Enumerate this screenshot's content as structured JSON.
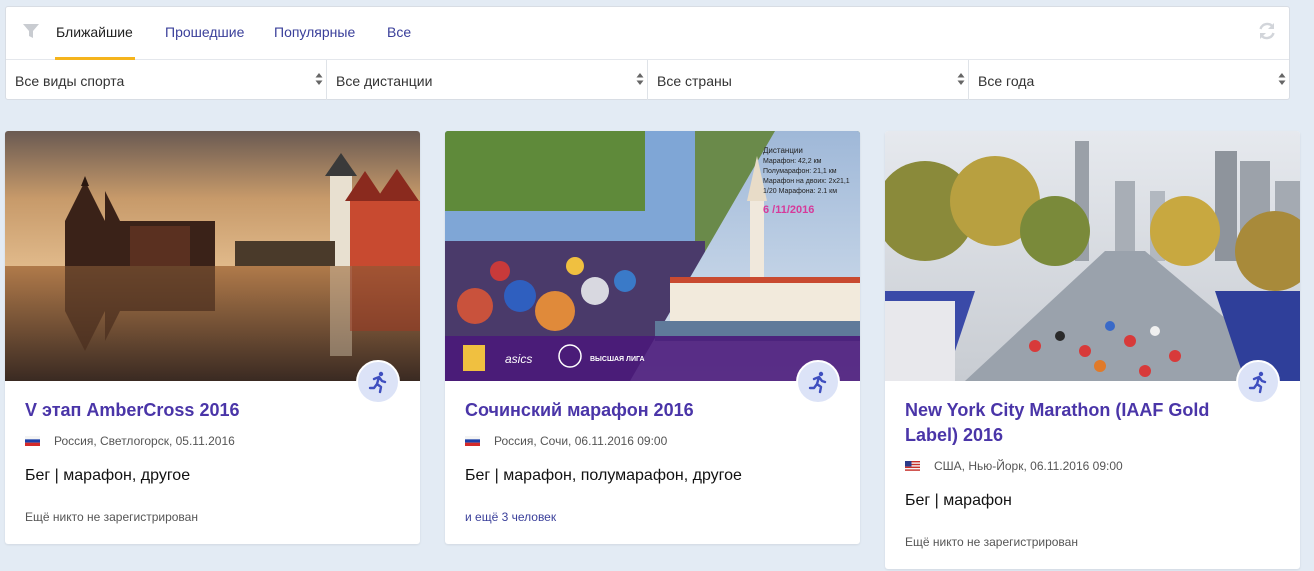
{
  "tabs": [
    {
      "label": "Ближайшие",
      "active": true
    },
    {
      "label": "Прошедшие",
      "active": false
    },
    {
      "label": "Популярные",
      "active": false
    },
    {
      "label": "Все",
      "active": false
    }
  ],
  "filters": [
    {
      "value": "Все виды спорта"
    },
    {
      "value": "Все дистанции"
    },
    {
      "value": "Все страны"
    },
    {
      "value": "Все года"
    }
  ],
  "icons": {
    "filter": "filter-icon",
    "refresh": "refresh-icon",
    "sport": "running-man-icon",
    "sort": "sort-arrows-icon"
  },
  "colors": {
    "accent": "#f5b41c",
    "title": "#4a35a8",
    "link": "#3a3f9a",
    "badge": "#dce3f7"
  },
  "cards": [
    {
      "title": "V этап AmberCross 2016",
      "flag": "russia",
      "location": "Россия, Светлогорск, 05.11.2016",
      "sports": "Бег | марафон, другое",
      "registration": "Ещё никто не зарегистрирован",
      "registration_is_link": false
    },
    {
      "title": "Сочинский марафон 2016",
      "flag": "russia",
      "location": "Россия, Сочи, 06.11.2016 09:00",
      "sports": "Бег | марафон, полумарафон, другое",
      "registration": "и ещё 3 человек",
      "registration_is_link": true,
      "poster": {
        "distances_title": "Дистанции",
        "lines": [
          "Марафон: 42,2 км",
          "Полумарафон: 21,1 км",
          "Марафон на двоих: 2х21,1",
          "1/20 Марафона: 2.1 км"
        ],
        "date": "6 /11/2016",
        "sponsor1": "asics",
        "sponsor2": "ВЫСШАЯ ЛИГА"
      }
    },
    {
      "title": "New York City Marathon (IAAF Gold Label) 2016",
      "flag": "usa",
      "location": "США, Нью-Йорк, 06.11.2016 09:00",
      "sports": "Бег | марафон",
      "registration": "Ещё никто не зарегистрирован",
      "registration_is_link": false
    }
  ]
}
